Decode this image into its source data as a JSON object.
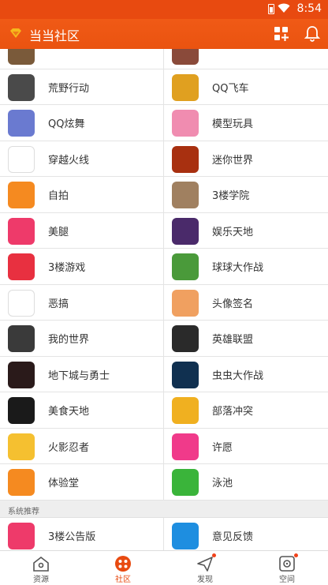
{
  "status_bar": {
    "time": "8:54"
  },
  "app_bar": {
    "title": "当当社区"
  },
  "grid": [
    {
      "left": {
        "label": "",
        "icon": "game-cover-icon",
        "color": "#7a5a3a"
      },
      "right": {
        "label": "",
        "icon": "photo-icon",
        "color": "#8a4a3a"
      }
    },
    {
      "left": {
        "label": "荒野行动",
        "icon": "soldier-game-icon",
        "color": "#4a4a4a"
      },
      "right": {
        "label": "QQ飞车",
        "icon": "racer-game-icon",
        "color": "#e0a020"
      }
    },
    {
      "left": {
        "label": "QQ炫舞",
        "icon": "dancer-game-icon",
        "color": "#6a7ad0"
      },
      "right": {
        "label": "模型玩具",
        "icon": "model-toy-icon",
        "color": "#f08cb0"
      }
    },
    {
      "left": {
        "label": "穿越火线",
        "icon": "crossfire-logo-icon",
        "color": "#ffffff"
      },
      "right": {
        "label": "迷你世界",
        "icon": "mini-world-icon",
        "color": "#a83010"
      }
    },
    {
      "left": {
        "label": "自拍",
        "icon": "camera-icon",
        "color": "#f58a20"
      },
      "right": {
        "label": "3楼学院",
        "icon": "book-icon",
        "color": "#a08060"
      }
    },
    {
      "left": {
        "label": "美腿",
        "icon": "leg-icon",
        "color": "#ee3a6a"
      },
      "right": {
        "label": "娱乐天地",
        "icon": "crown-star-icon",
        "color": "#4a2a6a"
      }
    },
    {
      "left": {
        "label": "3楼游戏",
        "icon": "gameboy-icon",
        "color": "#e83040"
      },
      "right": {
        "label": "球球大作战",
        "icon": "ball-game-icon",
        "color": "#4a9a3a"
      }
    },
    {
      "left": {
        "label": "恶搞",
        "icon": "meme-face-icon",
        "color": "#ffffff"
      },
      "right": {
        "label": "头像签名",
        "icon": "avatar-cartoon-icon",
        "color": "#f0a060"
      }
    },
    {
      "left": {
        "label": "我的世界",
        "icon": "minecraft-icon",
        "color": "#3a3a3a"
      },
      "right": {
        "label": "英雄联盟",
        "icon": "lol-logo-icon",
        "color": "#2a2a2a"
      }
    },
    {
      "left": {
        "label": "地下城与勇士",
        "icon": "dungeon-icon",
        "color": "#2a1a1a"
      },
      "right": {
        "label": "虫虫大作战",
        "icon": "eyeball-icon",
        "color": "#103050"
      }
    },
    {
      "left": {
        "label": "美食天地",
        "icon": "food-icon",
        "color": "#1a1a1a"
      },
      "right": {
        "label": "部落冲突",
        "icon": "clash-icon",
        "color": "#f0b020"
      }
    },
    {
      "left": {
        "label": "火影忍者",
        "icon": "naruto-icon",
        "color": "#f5c030"
      },
      "right": {
        "label": "许愿",
        "icon": "heart-icon",
        "color": "#f03a8a"
      }
    },
    {
      "left": {
        "label": "体验堂",
        "icon": "gamepad-icon",
        "color": "#f58a20"
      },
      "right": {
        "label": "泳池",
        "icon": "lifebuoy-icon",
        "color": "#3ab43a"
      }
    }
  ],
  "section": {
    "label": "系统推荐"
  },
  "recommend": [
    {
      "left": {
        "label": "3楼公告版",
        "icon": "notice-board-icon",
        "color": "#ee3a6a"
      },
      "right": {
        "label": "意见反馈",
        "icon": "mail-icon",
        "color": "#1e8ee0"
      }
    }
  ],
  "tabs": [
    {
      "label": "资源",
      "icon": "home-icon",
      "active": false
    },
    {
      "label": "社区",
      "icon": "community-icon",
      "active": true
    },
    {
      "label": "发现",
      "icon": "discover-icon",
      "active": false
    },
    {
      "label": "空间",
      "icon": "space-icon",
      "active": false
    }
  ],
  "colors": {
    "brand": "#e84a10",
    "divider": "#e4e4e4"
  }
}
